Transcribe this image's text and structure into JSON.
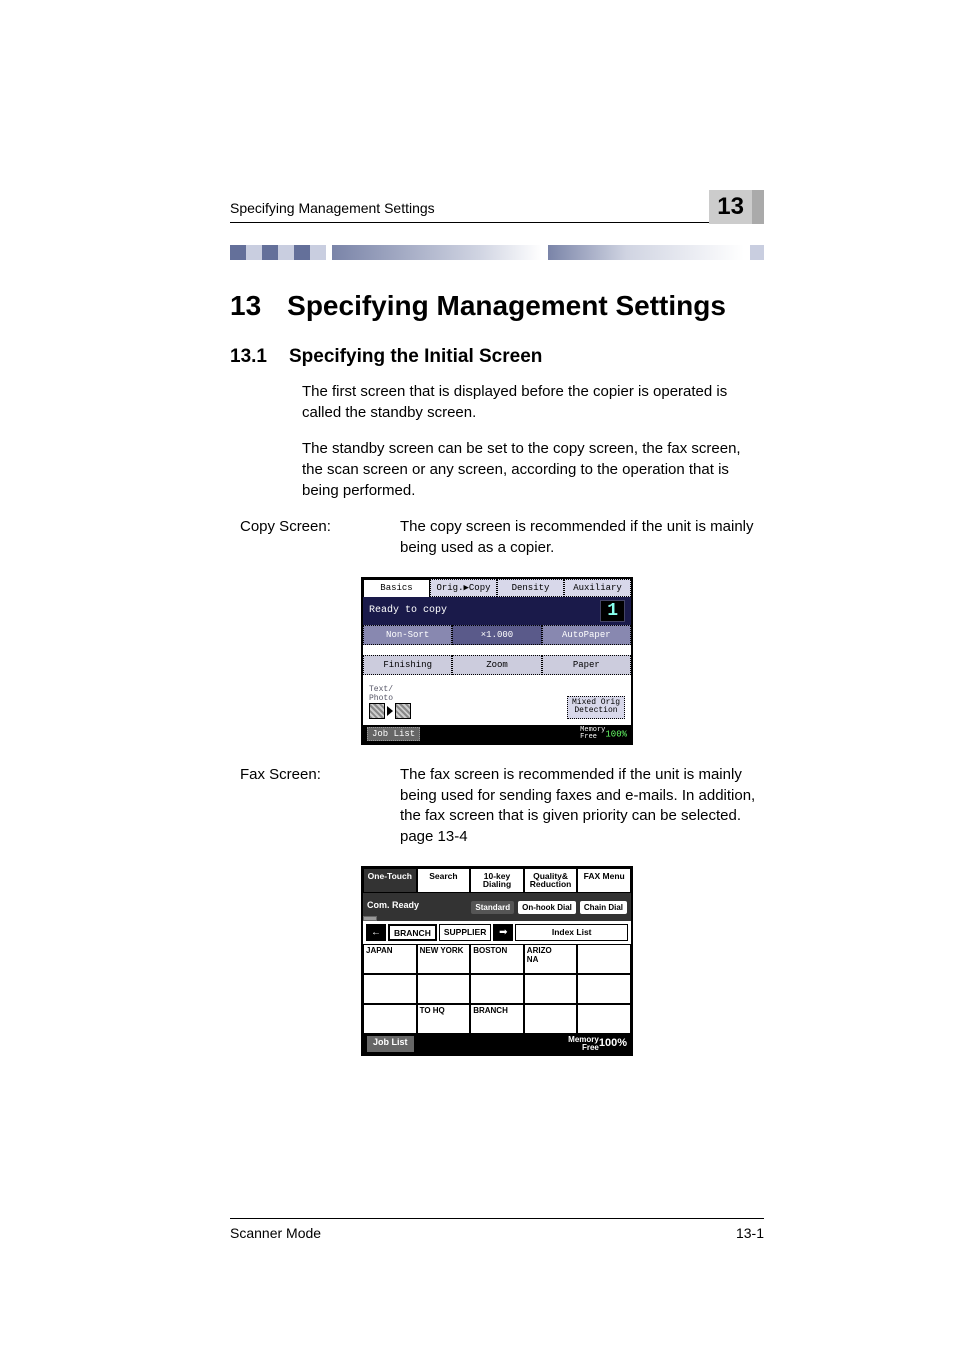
{
  "header": {
    "running_title": "Specifying Management Settings",
    "chapter_badge": "13"
  },
  "chapter": {
    "number": "13",
    "title": "Specifying Management Settings"
  },
  "section": {
    "number": "13.1",
    "title": "Specifying the Initial Screen"
  },
  "paragraphs": {
    "p1": "The first screen that is displayed before the copier is operated is called the standby screen.",
    "p2": "The standby screen can be set to the copy screen, the fax screen, the scan screen or any screen, according to the operation that is being performed."
  },
  "entries": {
    "copy": {
      "label": "Copy Screen:",
      "desc": "The copy screen is recommended if the unit is mainly being used as a copier."
    },
    "fax": {
      "label": "Fax Screen:",
      "desc": "The fax screen is recommended if the unit is mainly being used for sending faxes and e-mails. In addition, the fax screen that is given priority can be selected.",
      "page_ref": "page 13-4"
    }
  },
  "copy_screen": {
    "tabs": {
      "basics": "Basics",
      "origcopy": "Orig.▶Copy",
      "density": "Density",
      "auxiliary": "Auxiliary"
    },
    "status_text": "Ready to copy",
    "count": "1",
    "row1": {
      "nonsort": "Non-Sort",
      "zoom": "×1.000",
      "autopaper": "AutoPaper"
    },
    "row2": {
      "finishing": "Finishing",
      "zoom": "Zoom",
      "paper": "Paper"
    },
    "text_photo": "Text/\nPhoto",
    "mixed_orig": "Mixed Orig\nDetection",
    "job_list": "Job List",
    "memory": "Memory\nFree",
    "memory_pct": "100%"
  },
  "fax_screen": {
    "tabs": {
      "onetouch": "One-Touch",
      "search": "Search",
      "tenkey": "10-key\nDialing",
      "quality": "Quality&\nReduction",
      "faxmenu": "FAX Menu"
    },
    "status": {
      "com_ready": "Com. Ready",
      "standard": "Standard",
      "onhook": "On-hook Dial",
      "chain": "Chain Dial"
    },
    "indices": {
      "left_arrow": "←",
      "branch": "BRANCH",
      "supplier": "SUPPLIER",
      "right_arrow": "➡",
      "index_list": "Index List"
    },
    "cells": {
      "r1c1": "JAPAN",
      "r1c2": "NEW YORK",
      "r1c3": "BOSTON",
      "r1c4": "ARIZO\nNA",
      "r1c5": "",
      "r2c1": "",
      "r2c2": "",
      "r2c3": "",
      "r2c4": "",
      "r2c5": "",
      "r3c1": "",
      "r3c2": "TO HQ",
      "r3c3": "BRANCH",
      "r3c4": "",
      "r3c5": ""
    },
    "job_list": "Job List",
    "memory_label": "Memory\nFree",
    "memory_pct": "100%"
  },
  "footer": {
    "left": "Scanner Mode",
    "right": "13-1"
  }
}
